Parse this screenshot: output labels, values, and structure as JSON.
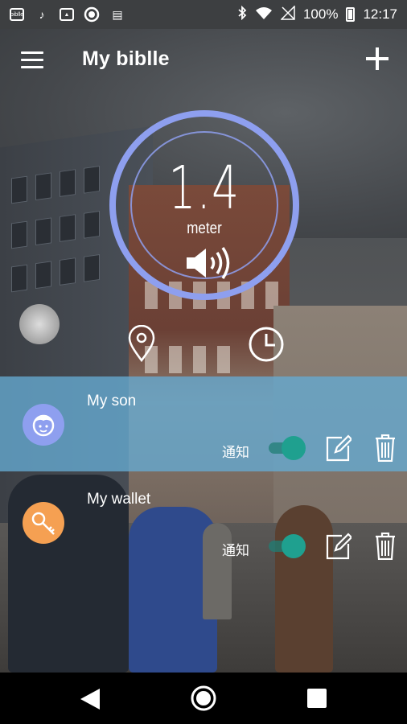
{
  "status_bar": {
    "left_icons": [
      "biblle-app-icon",
      "sound-icon",
      "image-icon",
      "record-icon",
      "device-icon"
    ],
    "battery_text": "100%",
    "time": "12:17"
  },
  "app_bar": {
    "title": "My biblle"
  },
  "gauge": {
    "distance_value": "1.4",
    "distance_unit": "meter",
    "ring_color": "#8e9fef"
  },
  "devices": [
    {
      "name": "My son",
      "notify_label": "通知",
      "notify_enabled": true,
      "avatar_icon": "boy-face-icon",
      "avatar_color": "#8e9fef",
      "selected": true
    },
    {
      "name": "My wallet",
      "notify_label": "通知",
      "notify_enabled": true,
      "avatar_icon": "key-icon",
      "avatar_color": "#f5a052",
      "selected": false
    }
  ],
  "colors": {
    "accent_toggle": "#1fa08f",
    "selected_row": "#65aad2"
  }
}
